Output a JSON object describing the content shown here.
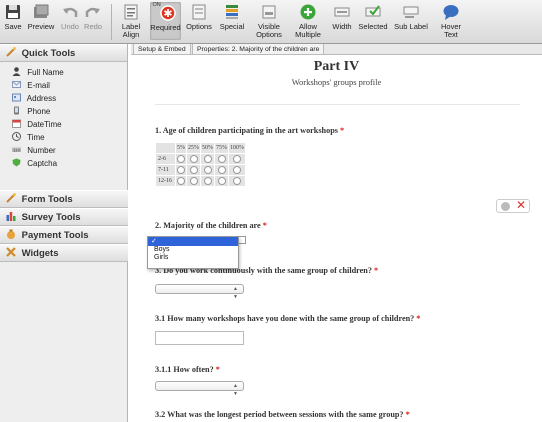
{
  "toolbar": {
    "save": "Save",
    "preview": "Preview",
    "undo": "Undo",
    "redo": "Redo",
    "label_align": "Label Align",
    "required": "Required",
    "required_toggle": "ON",
    "options": "Options",
    "special": "Special",
    "visible_options": "Visible Options",
    "allow_multiple": "Allow Multiple",
    "width": "Width",
    "selected": "Selected",
    "sub_label": "Sub Label",
    "hover_text": "Hover Text"
  },
  "sidebar": {
    "quick_tools": "Quick Tools",
    "items": [
      "Full Name",
      "E-mail",
      "Address",
      "Phone",
      "DateTime",
      "Time",
      "Number",
      "Captcha"
    ],
    "form_tools": "Form Tools",
    "survey_tools": "Survey Tools",
    "payment_tools": "Payment Tools",
    "widgets": "Widgets"
  },
  "tabs": {
    "setup": "Setup & Embed",
    "properties": "Properties: 2. Majority of the children are"
  },
  "form": {
    "title": "Part IV",
    "subtitle": "Workshops' groups profile",
    "q1": "1. Age of children participating in the art workshops",
    "grid_cols": [
      "5%",
      "25%",
      "50%",
      "75%",
      "100%"
    ],
    "grid_rows": [
      "2-6",
      "7-11",
      "12-16"
    ],
    "q2": "2. Majority of the children are",
    "q2_options": [
      "Boys",
      "Girls"
    ],
    "q3": "3. Do you work continuously with the same group of children?",
    "q31": "3.1 How many workshops have you done with the same group of children?",
    "q311": "3.1.1 How often?",
    "q32": "3.2 What was the longest period between sessions with the same group?",
    "required_mark": "*"
  },
  "colors": {
    "required": "#dd1111",
    "accent_orange": "#e8a23a",
    "delete_red": "#d9302a"
  }
}
